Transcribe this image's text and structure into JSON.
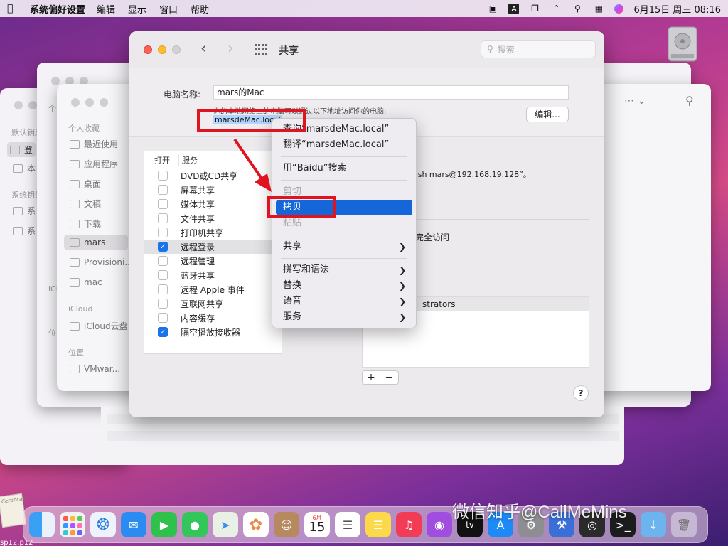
{
  "menubar": {
    "app": "系统偏好设置",
    "items": [
      "编辑",
      "显示",
      "窗口",
      "帮助"
    ],
    "clock": "6月15日 周三  08:16",
    "input_label": "A"
  },
  "bg_finder_left": {
    "heads": [
      "默认钥匙",
      "系统钥匙"
    ],
    "items": [
      "登",
      "本",
      "系",
      "系"
    ]
  },
  "bg_finder": {
    "section_favorites": "个人收藏",
    "items": [
      "最近使用",
      "应用程序",
      "桌面",
      "文稿",
      "下载",
      "mars",
      "Provisioni...",
      "mac"
    ],
    "section_icloud": "iCloud",
    "icloud_items": [
      "iCloud云盘"
    ],
    "section_location": "位置",
    "location_items": [
      "VMwar..."
    ],
    "peek_labels": [
      "个",
      "iCl",
      "位"
    ]
  },
  "window": {
    "title": "共享",
    "search_placeholder": "搜索",
    "computer_name_label": "电脑名称:",
    "computer_name_value": "mars的Mac",
    "hint": "你的本地网络上的电脑可以通过以下地址访问你的电脑:",
    "address": "marsdeMac.local",
    "edit_button": "编辑...",
    "services_header_on": "打开",
    "services_header_name": "服务",
    "services": [
      {
        "name": "DVD或CD共享",
        "on": false
      },
      {
        "name": "屏幕共享",
        "on": false
      },
      {
        "name": "媒体共享",
        "on": false
      },
      {
        "name": "文件共享",
        "on": false
      },
      {
        "name": "打印机共享",
        "on": false
      },
      {
        "name": "远程登录",
        "on": true
      },
      {
        "name": "远程管理",
        "on": false
      },
      {
        "name": "蓝牙共享",
        "on": false
      },
      {
        "name": "远程 Apple 事件",
        "on": false
      },
      {
        "name": "互联网共享",
        "on": false
      },
      {
        "name": "内容缓存",
        "on": false
      },
      {
        "name": "隔空播放接收器",
        "on": true
      }
    ],
    "ssh_text": "ssh mars@192.168.19.128”。",
    "full_access_text": "完全访问",
    "users_row": "strators",
    "plus": "+",
    "minus": "−",
    "help": "?"
  },
  "context_menu": {
    "items": [
      {
        "label": "查询“marsdeMac.local”",
        "state": "normal"
      },
      {
        "label": "翻译“marsdeMac.local”",
        "state": "normal"
      },
      {
        "sep": true
      },
      {
        "label": "用“Baidu”搜索",
        "state": "normal"
      },
      {
        "sep": true
      },
      {
        "label": "剪切",
        "state": "disabled"
      },
      {
        "label": "拷贝",
        "state": "highlighted"
      },
      {
        "label": "粘贴",
        "state": "disabled"
      },
      {
        "sep": true
      },
      {
        "label": "共享",
        "state": "submenu"
      },
      {
        "sep": true
      },
      {
        "label": "拼写和语法",
        "state": "submenu"
      },
      {
        "label": "替换",
        "state": "submenu"
      },
      {
        "label": "语音",
        "state": "submenu"
      },
      {
        "label": "服务",
        "state": "submenu"
      }
    ]
  },
  "dock": {
    "calendar_month": "6月",
    "calendar_day": "15",
    "tv_label": "tv"
  },
  "watermark": "微信知乎@CallMeMins",
  "certificate_text": "Certificate",
  "bottom_label": "sp12.p12",
  "colors": {
    "accent": "#1466d9",
    "annotation": "#e0141e",
    "close": "#fe5f57",
    "minimize": "#febc2e"
  }
}
